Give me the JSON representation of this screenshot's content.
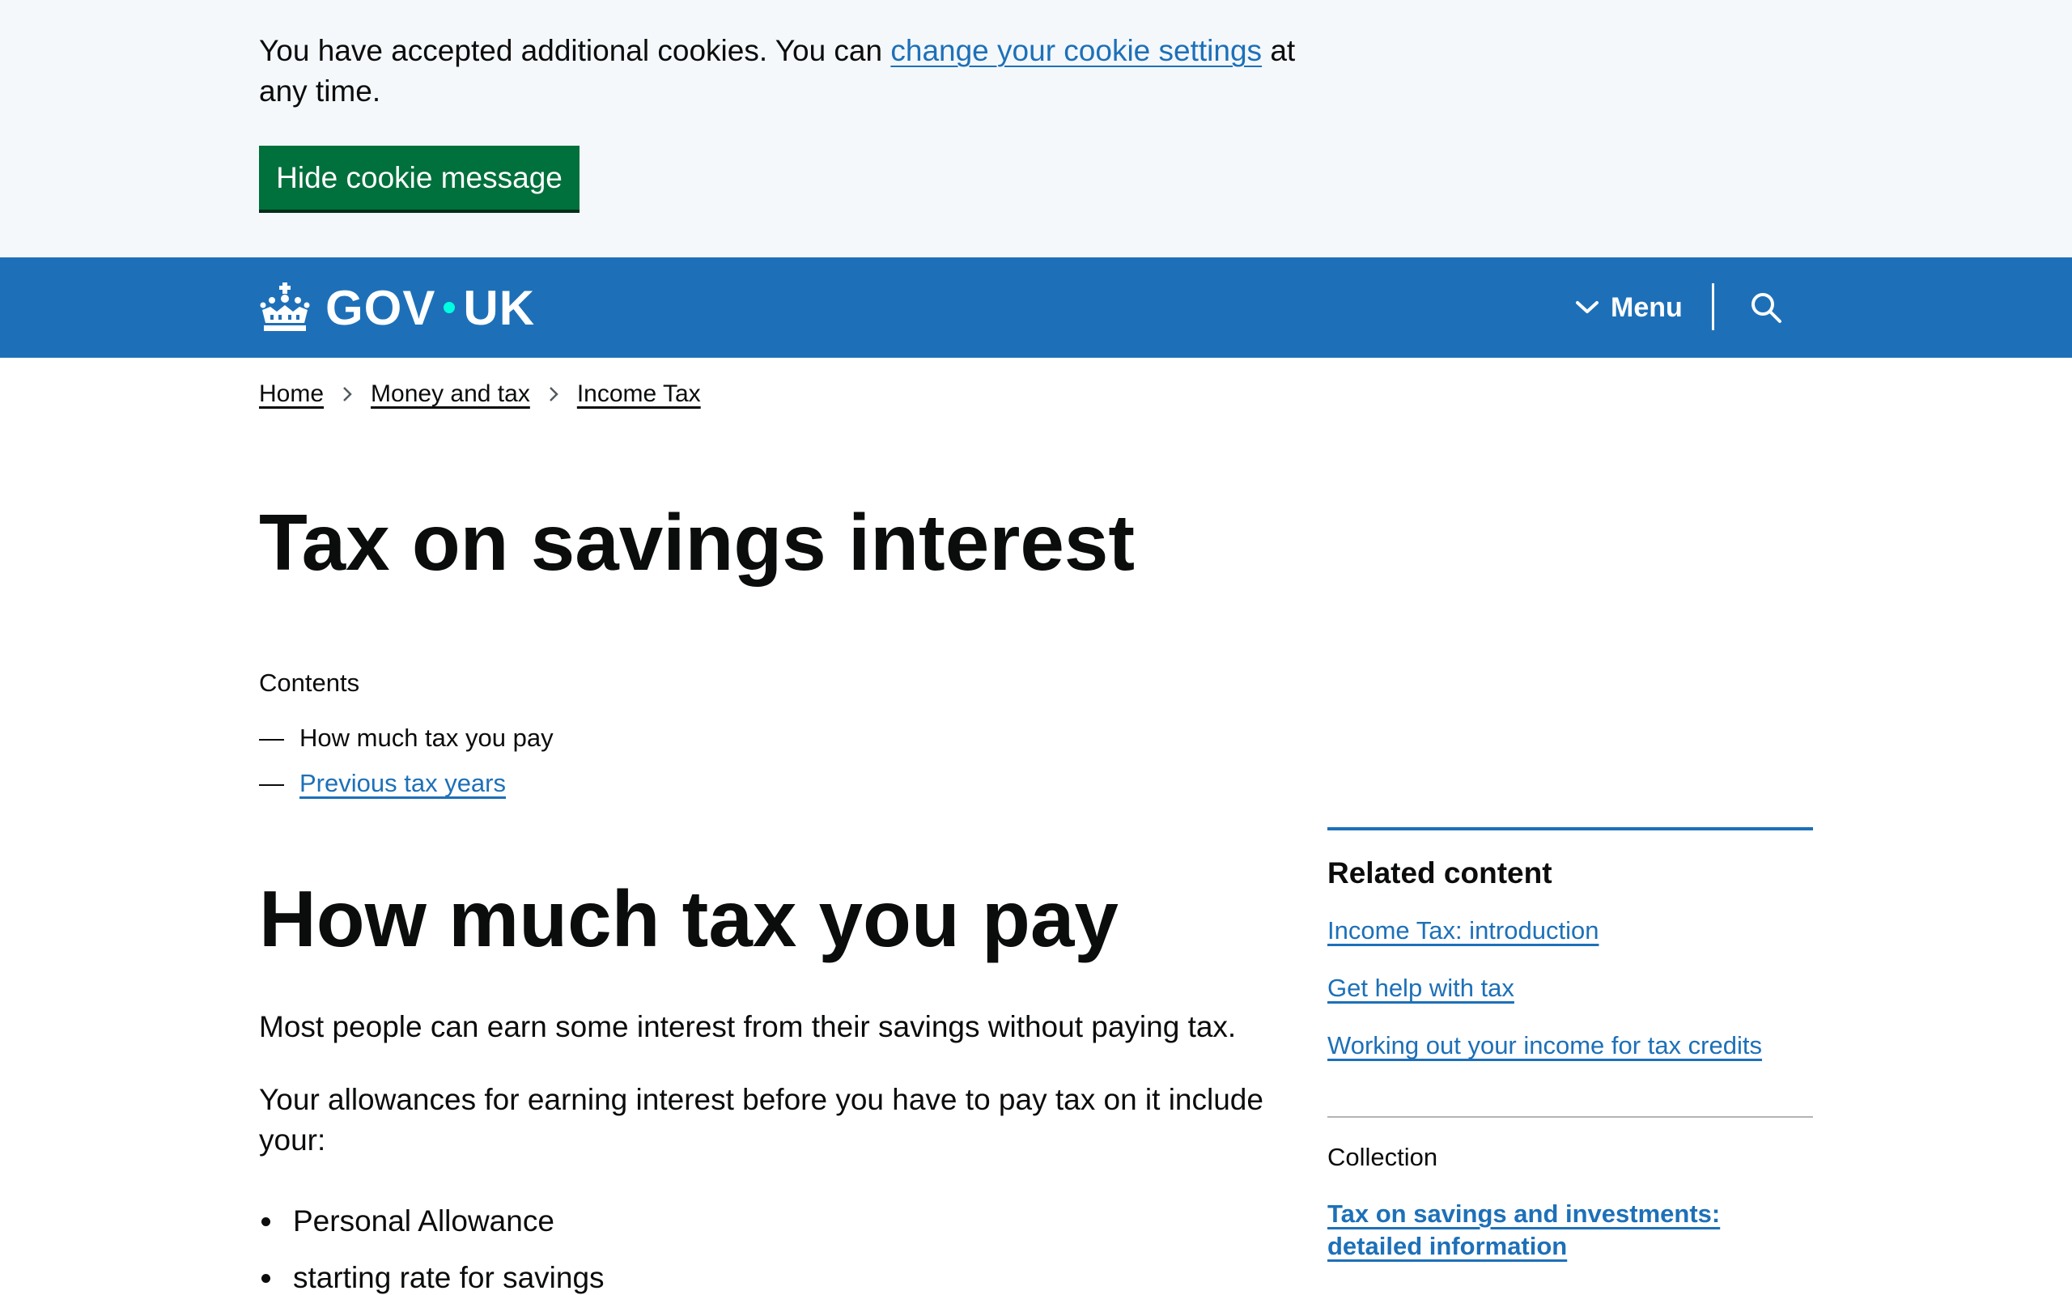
{
  "cookie_banner": {
    "text_before": "You have accepted additional cookies. You can ",
    "link_text": "change your cookie settings",
    "text_after": " at any time.",
    "hide_button_label": "Hide cookie message"
  },
  "header": {
    "logo_left": "GOV",
    "logo_right": "UK",
    "menu_label": "Menu",
    "icons": [
      "crown-icon",
      "chevron-down-icon",
      "search-icon"
    ]
  },
  "breadcrumbs": [
    "Home",
    "Money and tax",
    "Income Tax"
  ],
  "page": {
    "title": "Tax on savings interest"
  },
  "contents": {
    "label": "Contents",
    "items": [
      {
        "dash": "—",
        "label": "How much tax you pay",
        "current": true
      },
      {
        "dash": "—",
        "label": "Previous tax years",
        "current": false
      }
    ]
  },
  "main": {
    "heading": "How much tax you pay",
    "para1": "Most people can earn some interest from their savings without paying tax.",
    "para2": "Your allowances for earning interest before you have to pay tax on it include your:",
    "bullets": [
      "Personal Allowance",
      "starting rate for savings"
    ]
  },
  "sidebar": {
    "related_heading": "Related content",
    "related_links": [
      "Income Tax: introduction",
      "Get help with tax",
      "Working out your income for tax credits"
    ],
    "collection_label": "Collection",
    "collection_link": "Tax on savings and investments: detailed information"
  },
  "colors": {
    "brand_blue": "#1d70b8",
    "button_green": "#00703c",
    "banner_bg": "#f4f8fb",
    "text": "#0b0c0c",
    "logo_dot": "#00ffe0"
  }
}
